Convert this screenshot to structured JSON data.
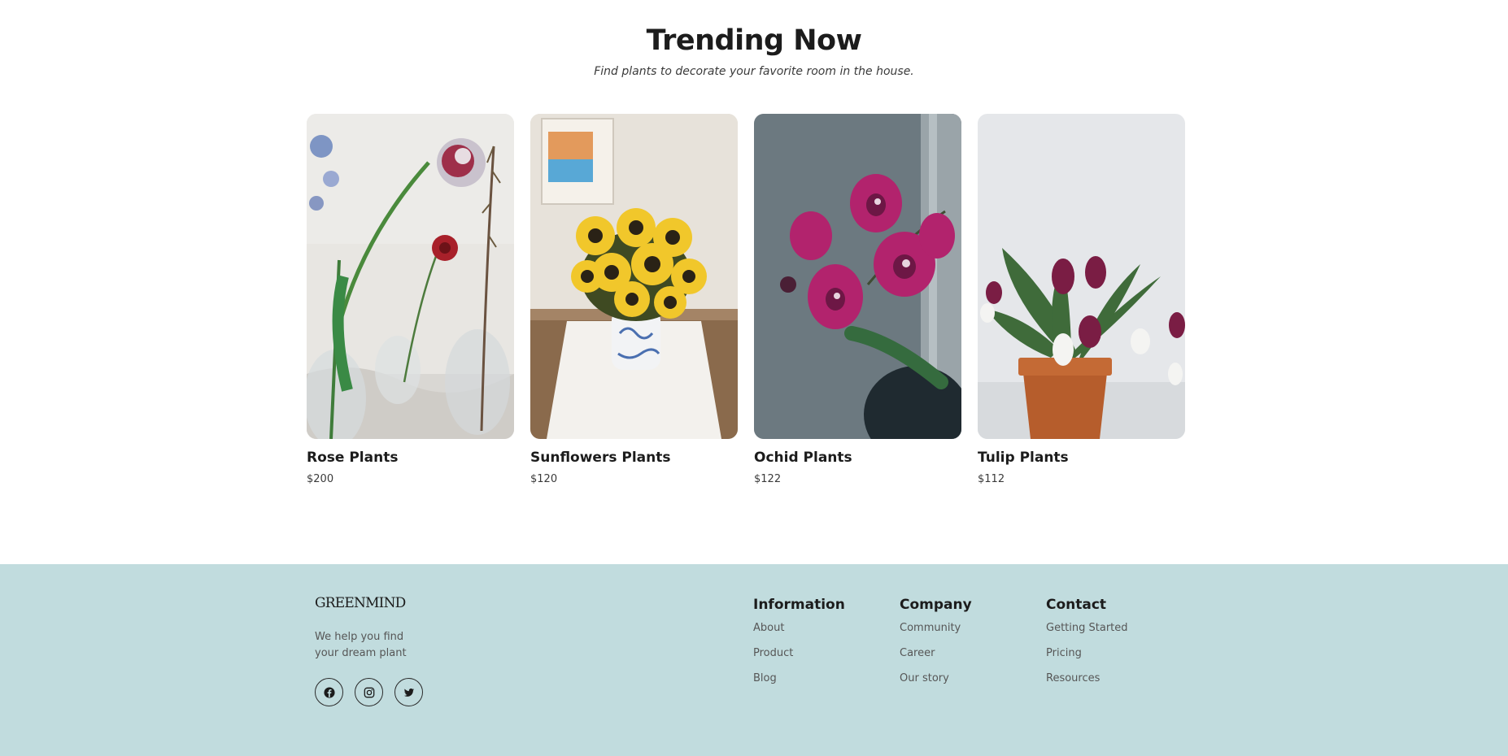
{
  "trending": {
    "title": "Trending Now",
    "subtitle": "Find plants to decorate your favorite room in the house."
  },
  "products": [
    {
      "name": "Rose Plants",
      "price": "$200"
    },
    {
      "name": "Sunflowers Plants",
      "price": "$120"
    },
    {
      "name": "Ochid Plants",
      "price": "$122"
    },
    {
      "name": "Tulip Plants",
      "price": "$112"
    }
  ],
  "footer": {
    "brand": "GREENMIND",
    "tagline": "We help you find your dream plant",
    "socials": [
      {
        "icon": "facebook-icon"
      },
      {
        "icon": "instagram-icon"
      },
      {
        "icon": "twitter-icon"
      }
    ],
    "columns": [
      {
        "title": "Information",
        "links": [
          "About",
          "Product",
          "Blog"
        ]
      },
      {
        "title": "Company",
        "links": [
          "Community",
          "Career",
          "Our story"
        ]
      },
      {
        "title": "Contact",
        "links": [
          "Getting Started",
          "Pricing",
          "Resources"
        ]
      }
    ]
  },
  "colors": {
    "footer_bg": "#c1dcde",
    "heading": "#1c1c1c",
    "muted": "#565656"
  }
}
